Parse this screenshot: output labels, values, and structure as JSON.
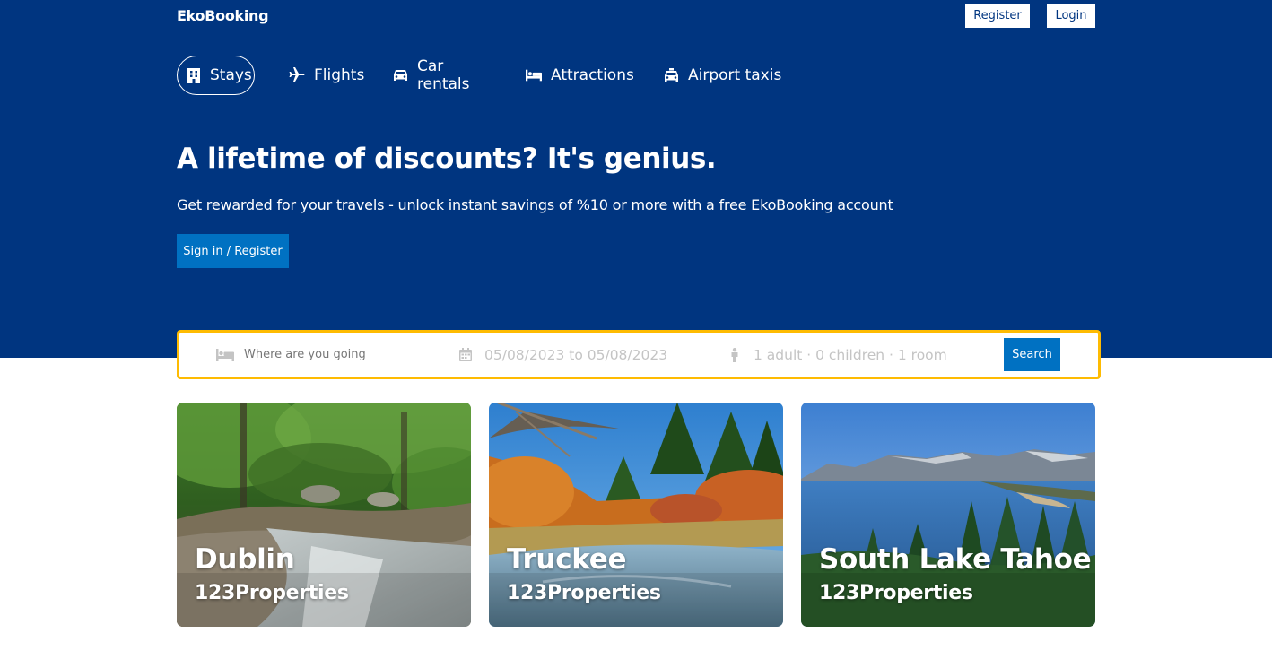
{
  "brand": {
    "name": "EkoBooking"
  },
  "header_buttons": {
    "register": "Register",
    "login": "Login"
  },
  "nav": {
    "items": [
      {
        "label": "Stays",
        "icon": "bed-building-icon",
        "active": true
      },
      {
        "label": "Flights",
        "icon": "plane-icon",
        "active": false
      },
      {
        "label": "Car rentals",
        "icon": "car-icon",
        "active": false
      },
      {
        "label": "Attractions",
        "icon": "bed-icon",
        "active": false
      },
      {
        "label": "Airport taxis",
        "icon": "taxi-icon",
        "active": false
      }
    ]
  },
  "hero": {
    "title": "A lifetime of discounts? It's genius.",
    "subtitle": "Get rewarded for your travels - unlock instant savings of %10 or more with a free EkoBooking account",
    "cta": "Sign in / Register"
  },
  "search": {
    "destination_placeholder": "Where are you going",
    "destination_value": "",
    "dates": "05/08/2023 to 05/08/2023",
    "guests": "1 adult · 0 children · 1 room",
    "button": "Search"
  },
  "featured": [
    {
      "city": "Dublin",
      "properties": "123Properties"
    },
    {
      "city": "Truckee",
      "properties": "123Properties"
    },
    {
      "city": "South Lake Tahoe",
      "properties": "123Properties"
    }
  ],
  "colors": {
    "header_bg": "#003580",
    "primary_button": "#0071c2",
    "search_border": "#febb02"
  }
}
